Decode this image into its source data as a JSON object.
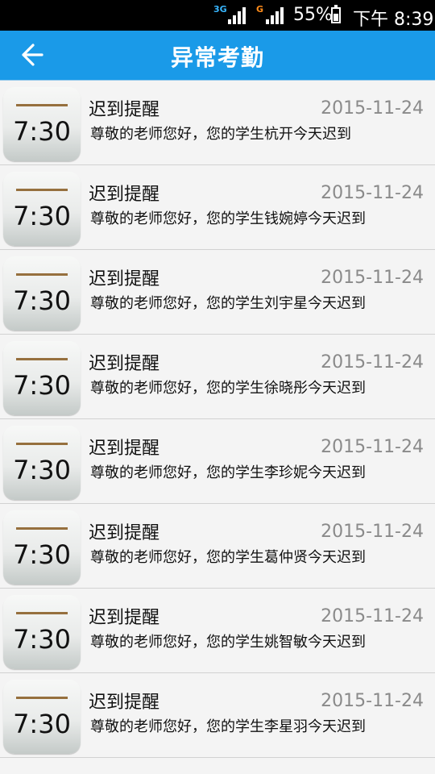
{
  "status_bar": {
    "network_1": "3G",
    "network_2": "G",
    "battery": "55%",
    "battery_level": 0.55,
    "time": "下午 8:39",
    "network_1_color": "#38b6ff",
    "network_2_color": "#ff8c1a"
  },
  "header": {
    "title": "异常考勤",
    "back_icon": "arrow-left-icon",
    "color": "#1a9ae8"
  },
  "alerts": [
    {
      "time": "7:30",
      "title": "迟到提醒",
      "date": "2015-11-24",
      "message": "尊敬的老师您好，您的学生杭开今天迟到"
    },
    {
      "time": "7:30",
      "title": "迟到提醒",
      "date": "2015-11-24",
      "message": "尊敬的老师您好，您的学生钱婉婷今天迟到"
    },
    {
      "time": "7:30",
      "title": "迟到提醒",
      "date": "2015-11-24",
      "message": "尊敬的老师您好，您的学生刘宇星今天迟到"
    },
    {
      "time": "7:30",
      "title": "迟到提醒",
      "date": "2015-11-24",
      "message": "尊敬的老师您好，您的学生徐晓彤今天迟到"
    },
    {
      "time": "7:30",
      "title": "迟到提醒",
      "date": "2015-11-24",
      "message": "尊敬的老师您好，您的学生李珍妮今天迟到"
    },
    {
      "time": "7:30",
      "title": "迟到提醒",
      "date": "2015-11-24",
      "message": "尊敬的老师您好，您的学生葛仲贤今天迟到"
    },
    {
      "time": "7:30",
      "title": "迟到提醒",
      "date": "2015-11-24",
      "message": "尊敬的老师您好，您的学生姚智敏今天迟到"
    },
    {
      "time": "7:30",
      "title": "迟到提醒",
      "date": "2015-11-24",
      "message": "尊敬的老师您好，您的学生李星羽今天迟到"
    }
  ]
}
